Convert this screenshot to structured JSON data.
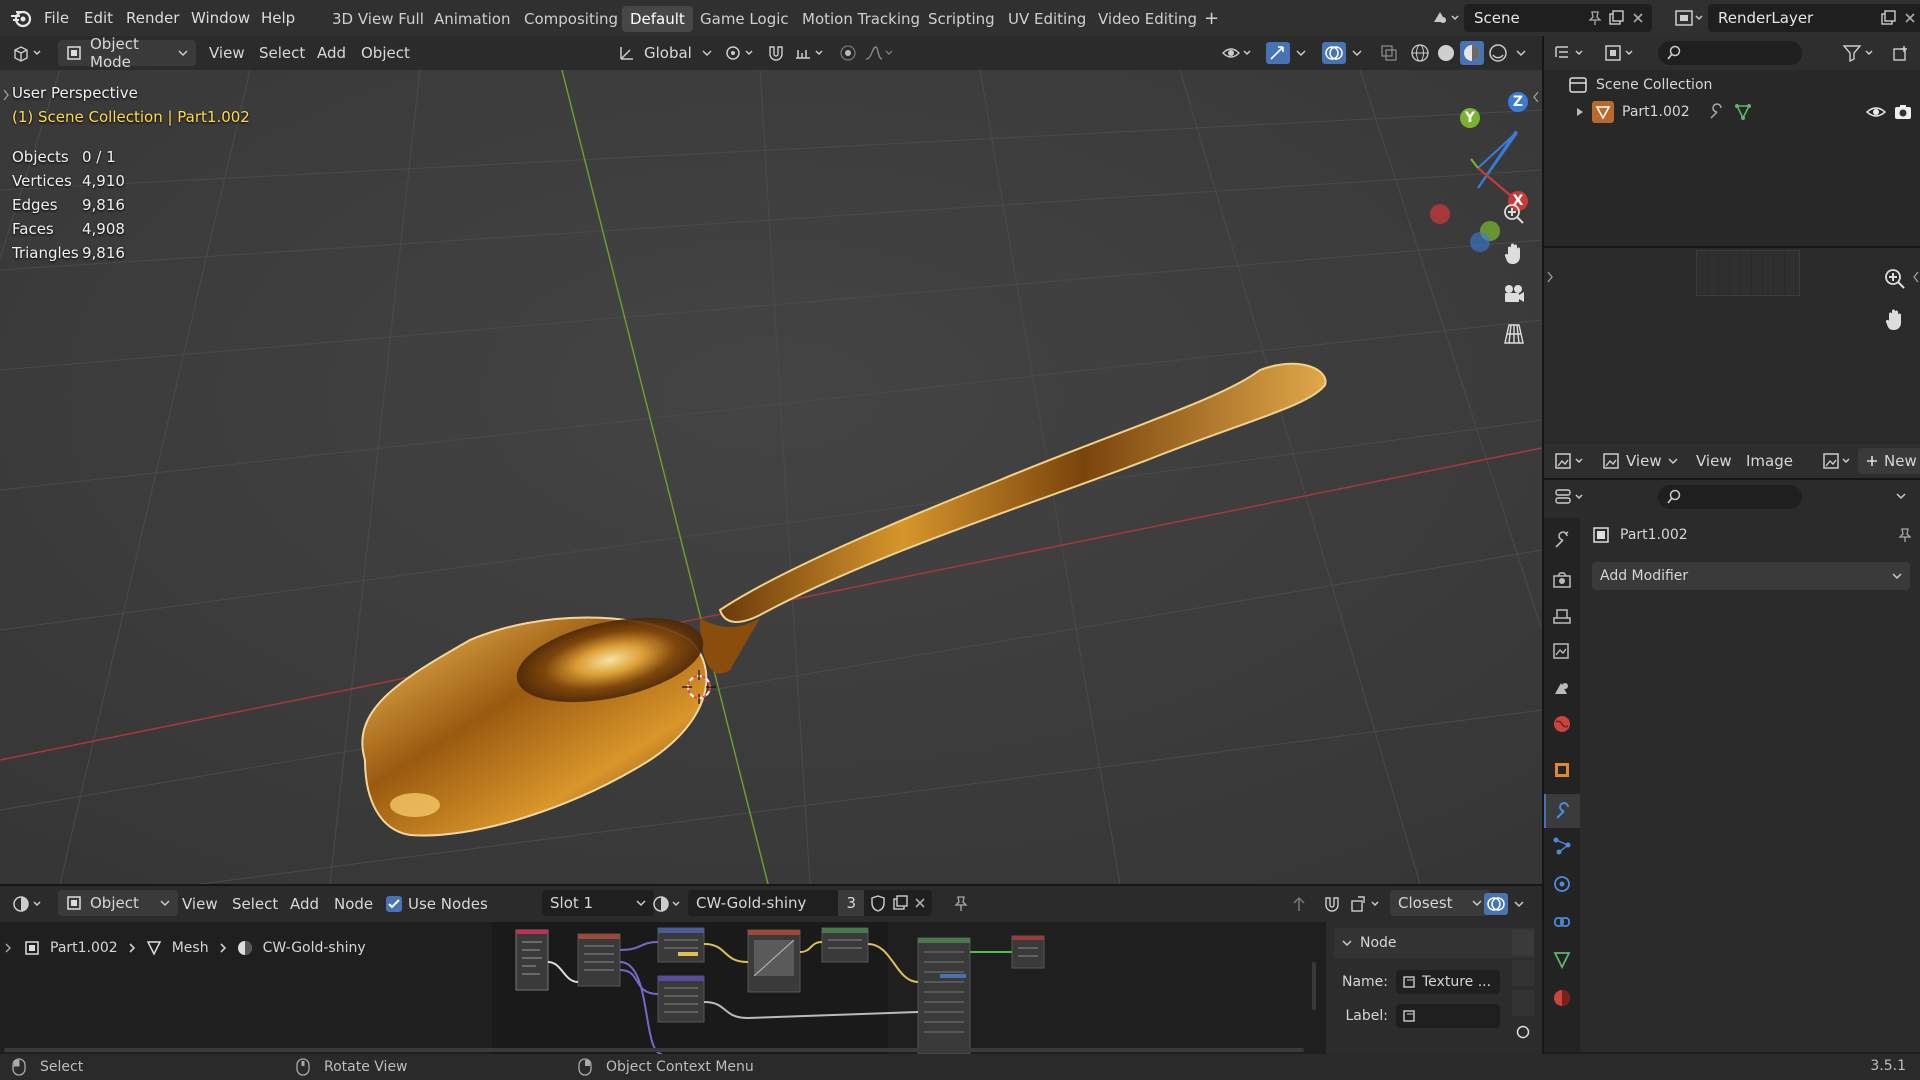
{
  "topbar": {
    "menus": [
      "File",
      "Edit",
      "Render",
      "Window",
      "Help"
    ],
    "workspaces": [
      "3D View Full",
      "Animation",
      "Compositing",
      "Default",
      "Game Logic",
      "Motion Tracking",
      "Scripting",
      "UV Editing",
      "Video Editing"
    ],
    "active_workspace": "Default",
    "add_tab": "+",
    "scene": "Scene",
    "render_layer": "RenderLayer"
  },
  "viewport_header": {
    "mode": "Object Mode",
    "menus": [
      "View",
      "Select",
      "Add",
      "Object"
    ],
    "transform_orientation": "Global"
  },
  "viewport": {
    "perspective": "User Perspective",
    "collection": "(1) Scene Collection | Part1.002",
    "stats": [
      {
        "label": "Objects",
        "value": "0 / 1"
      },
      {
        "label": "Vertices",
        "value": "4,910"
      },
      {
        "label": "Edges",
        "value": "9,816"
      },
      {
        "label": "Faces",
        "value": "4,908"
      },
      {
        "label": "Triangles",
        "value": "9,816"
      }
    ],
    "gizmo": {
      "x": "X",
      "y": "Y",
      "z": "Z"
    }
  },
  "outliner": {
    "root": "Scene Collection",
    "items": [
      {
        "label": "Part1.002"
      }
    ]
  },
  "image_editor": {
    "view_label": "View",
    "menus": [
      "View",
      "Image"
    ],
    "new_label": "New"
  },
  "properties": {
    "object_name": "Part1.002",
    "add_modifier": "Add Modifier"
  },
  "node_editor": {
    "object_label": "Object",
    "menus": [
      "View",
      "Select",
      "Add",
      "Node"
    ],
    "use_nodes": "Use Nodes",
    "slot": "Slot 1",
    "material": "CW-Gold-shiny",
    "users": "3",
    "interpolation": "Closest",
    "breadcrumb": [
      "Part1.002",
      "Mesh",
      "CW-Gold-shiny"
    ],
    "side_panel": {
      "title": "Node",
      "name_label": "Name:",
      "name_value": "Texture ...",
      "label_label": "Label:",
      "label_value": ""
    }
  },
  "statusbar": {
    "select": "Select",
    "rotate": "Rotate View",
    "context": "Object Context Menu",
    "version": "3.5.1"
  },
  "colors": {
    "accent": "#4772b3",
    "active_text": "#ffd94a",
    "x_axis": "#c83a3a",
    "y_axis": "#7ab330",
    "z_axis": "#3a7ad8",
    "gold": "#c98a1c"
  }
}
